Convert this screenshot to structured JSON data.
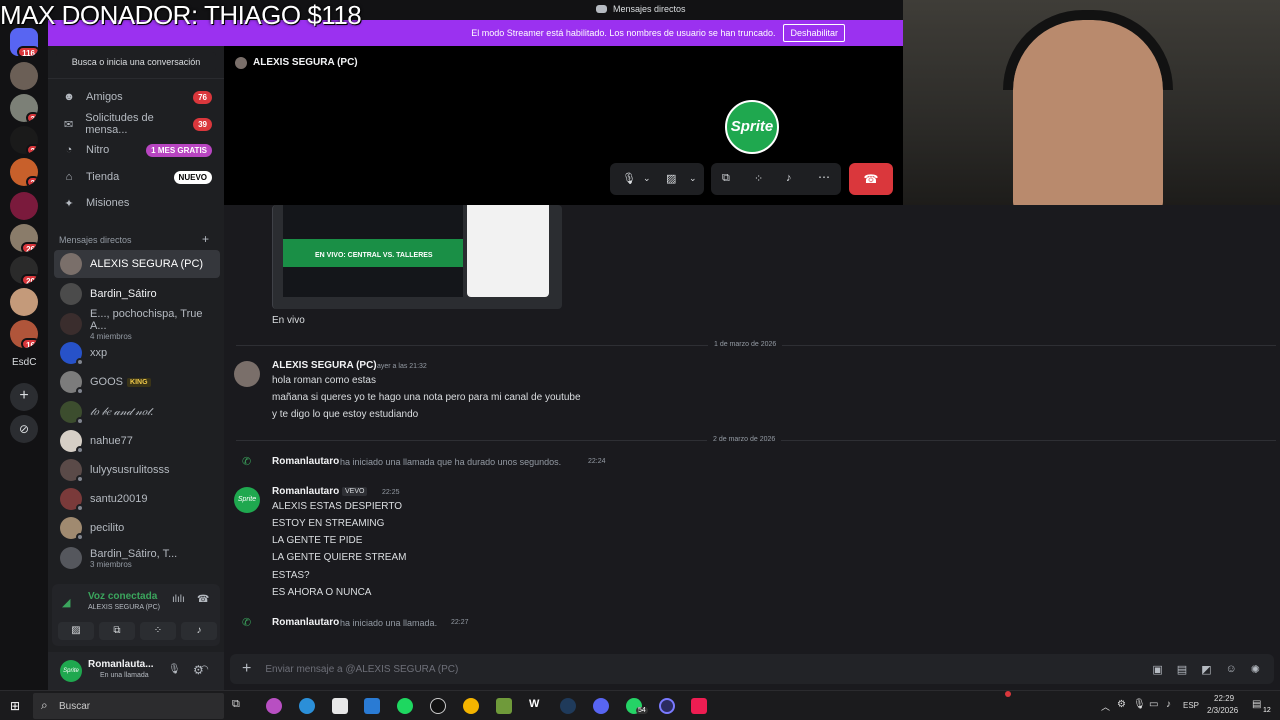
{
  "overlay": {
    "donor_text": "MAX DONADOR: THIAGO $118"
  },
  "window": {
    "title": "Mensajes directos"
  },
  "streamer_bar": {
    "text": "El modo Streamer está habilitado. Los nombres de usuario se han truncado.",
    "button": "Deshabilitar"
  },
  "rail": {
    "badges": [
      "116",
      "3",
      "2",
      "2",
      "26",
      "20",
      "16"
    ],
    "server_label": "EsdC"
  },
  "search": {
    "placeholder": "Busca o inicia una conversación"
  },
  "nav": [
    {
      "label": "Amigos",
      "badge": "76",
      "icon": "friends-icon"
    },
    {
      "label": "Solicitudes de mensa...",
      "badge": "39",
      "icon": "mail-icon"
    },
    {
      "label": "Nitro",
      "badge": "1 MES GRATIS",
      "icon": "nitro-icon"
    },
    {
      "label": "Tienda",
      "badge": "NUEVO",
      "icon": "shop-icon"
    },
    {
      "label": "Misiones",
      "badge": "",
      "icon": "quest-icon"
    }
  ],
  "dm_header": "Mensajes directos",
  "dms": [
    {
      "name": "ALEXIS SEGURA (PC)",
      "sub": ""
    },
    {
      "name": "Bardin_Sátiro",
      "sub": ""
    },
    {
      "name": "E..., pochochispa, True A...",
      "sub": "4 miembros"
    },
    {
      "name": "xxp",
      "sub": ""
    },
    {
      "name": "GOOS",
      "tag": "KING",
      "sub": ""
    },
    {
      "name": "𝓉𝑜 𝒷𝑒 𝒶𝓃𝒹 𝓃𝑜𝓉.",
      "sub": ""
    },
    {
      "name": "nahue77",
      "sub": ""
    },
    {
      "name": "lulyysusrulitosss",
      "sub": ""
    },
    {
      "name": "santu20019",
      "sub": ""
    },
    {
      "name": "pecilito",
      "sub": ""
    },
    {
      "name": "Bardin_Sátiro, T...",
      "sub": "3 miembros"
    }
  ],
  "voice": {
    "status": "Voz conectada",
    "channel": "ALEXIS SEGURA (PC)"
  },
  "user": {
    "name": "Romanlauta...",
    "status": "En una llamada"
  },
  "call": {
    "title": "ALEXIS SEGURA (PC)",
    "logo_text": "Sprite"
  },
  "embed": {
    "caption": "EN VIVO: CENTRAL VS. TALLERES"
  },
  "messages": {
    "en_vivo": "En vivo",
    "date1": "1 de marzo de 2026",
    "m1_author": "ALEXIS SEGURA (PC)",
    "m1_time": "ayer a las 21:32",
    "m1_lines": [
      "hola roman como estas",
      "mañana si queres yo te hago una nota pero para mi canal de youtube",
      "y te digo lo que estoy estudiando"
    ],
    "date2": "2 de marzo de 2026",
    "sys1_author": "Romanlautaro",
    "sys1_text": "ha iniciado una llamada que ha durado unos segundos.",
    "sys1_time": "22:24",
    "m2_author": "Romanlautaro",
    "m2_tag": "VEVO",
    "m2_time": "22:25",
    "m2_lines": [
      "ALEXIS ESTAS DESPIERTO",
      "ESTOY EN STREAMING",
      "LA GENTE TE PIDE",
      "LA GENTE QUIERE STREAM",
      "ESTAS?",
      "ES AHORA O NUNCA"
    ],
    "sys2_author": "Romanlautaro",
    "sys2_text": "ha iniciado una llamada.",
    "sys2_time": "22:27"
  },
  "composer": {
    "placeholder": "Enviar mensaje a @ALEXIS SEGURA (PC)"
  },
  "taskbar": {
    "search": "Buscar",
    "lang": "ESP",
    "time": "22:29",
    "date": "2/3/2026",
    "whatsapp_badge": "54",
    "notif_badge": "12"
  },
  "colors": {
    "accent": "#9b31f0",
    "danger": "#da373c",
    "sprite_green": "#1fa84f"
  }
}
